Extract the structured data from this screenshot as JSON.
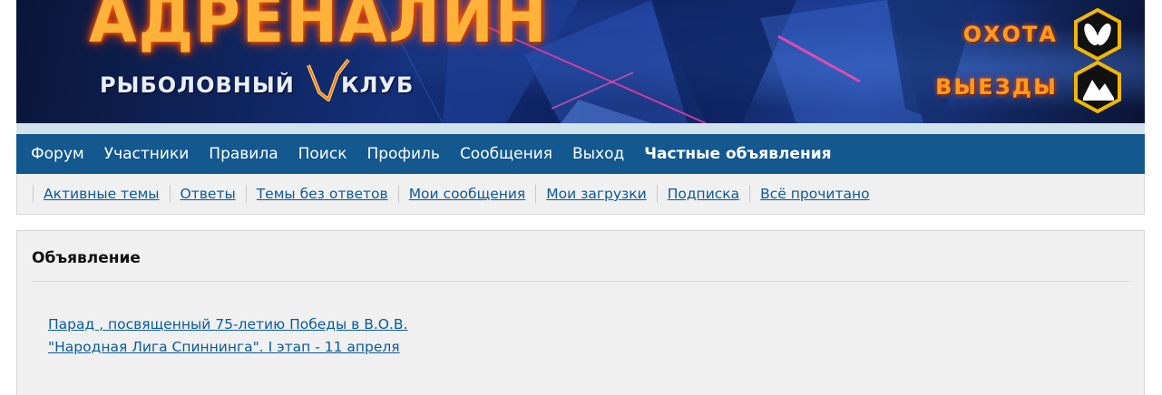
{
  "banner": {
    "logo_title": "АДРЕНАЛИН",
    "logo_sub_left": "РЫБОЛОВНЫЙ",
    "logo_sub_right": "КЛУБ",
    "links": [
      {
        "label": "ОХОТА",
        "icon": "flippers-icon"
      },
      {
        "label": "ВЫЕЗДЫ",
        "icon": "landscape-icon"
      }
    ],
    "accent_color": "#ff9a1a",
    "hex_border_color": "#f2b705"
  },
  "nav": {
    "items": [
      "Форум",
      "Участники",
      "Правила",
      "Поиск",
      "Профиль",
      "Сообщения",
      "Выход",
      "Частные объявления"
    ],
    "bg_color": "#13588f"
  },
  "subnav": {
    "items": [
      "Активные темы",
      "Ответы",
      "Темы без ответов",
      "Мои сообщения",
      "Мои загрузки",
      "Подписка",
      "Всё прочитано"
    ],
    "link_color": "#0a5a9c"
  },
  "announcement": {
    "title": "Объявление",
    "links": [
      "Парад , посвященный 75-летию Победы в В.О.В.",
      "\"Народная Лига Спиннинга\". I этап - 11 апреля"
    ]
  }
}
